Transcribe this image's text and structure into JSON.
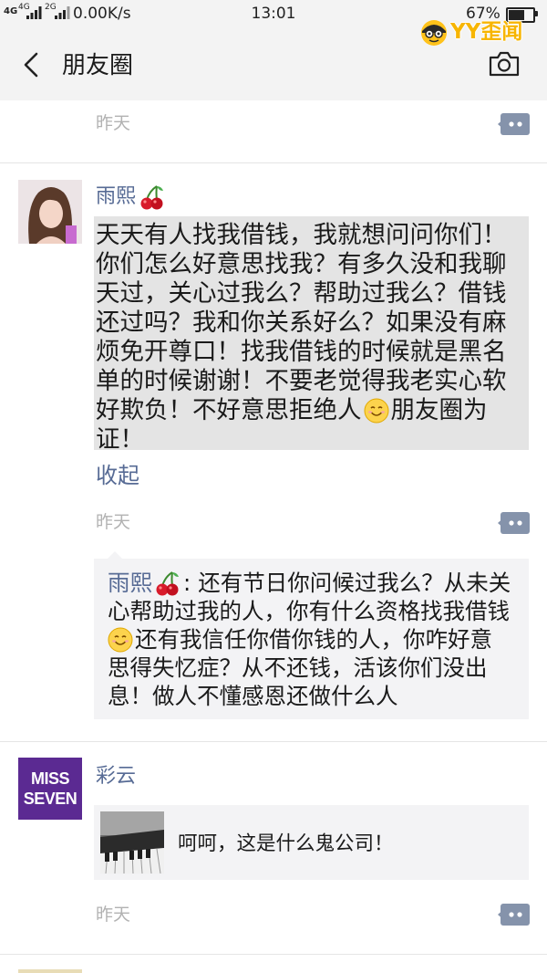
{
  "status_bar": {
    "network_a": "4G",
    "network_b": "4G",
    "network_c": "2G",
    "speed": "0.00K/s",
    "time": "13:01",
    "battery_text": "67%",
    "battery_level": 67
  },
  "watermark": {
    "text": "YY歪闻",
    "icon": "yy-logo-icon"
  },
  "nav": {
    "title": "朋友圈",
    "back_icon": "chevron-left-icon",
    "camera_icon": "camera-icon"
  },
  "feed": {
    "previous_post": {
      "time": "昨天"
    },
    "posts": [
      {
        "author": "雨熙",
        "author_emoji": "cherry-icon",
        "text_lines": [
          "天天有人找我借钱，我就想问问你们！",
          "你们怎么好意思找我？有多久没和我聊",
          "天过，关心过我么？帮助过我么？借钱",
          "还过吗？我和你关系好么？如果没有麻",
          "烦免开尊口！找我借钱的时候就是黑名",
          "单的时候谢谢！不要老觉得我老实心软",
          {
            "before_emoji": "好欺负！不好意思拒绝人",
            "emoji": "smile-icon",
            "after_emoji": "朋友圈为"
          },
          "证！"
        ],
        "collapse_label": "收起",
        "time": "昨天",
        "comments": [
          {
            "author": "雨熙",
            "author_emoji": "cherry-icon",
            "separator": ":",
            "text_lines": [
              "还有节日你问候过我么？从未关",
              "心帮助过我的人，你有什么资格找我借钱",
              {
                "emoji": "smile-icon",
                "after_emoji": "还有我信任你借你钱的人，你咋好意"
              },
              "思得失忆症？从不还钱，活该你们没出",
              "息！做人不懂感恩还做什么人"
            ]
          }
        ]
      },
      {
        "author": "彩云",
        "avatar_text": [
          "MISS",
          "SEVEN"
        ],
        "link": {
          "title": "呵呵，这是什么鬼公司！"
        },
        "time": "昨天"
      }
    ]
  },
  "colors": {
    "header_bg": "#f3f3f3",
    "link_blue": "#576b95",
    "time_gray": "#b2b2b2",
    "selected_text_bg": "#e4e4e4",
    "comment_bg": "#f3f3f5",
    "avatar_purple": "#5b2a92",
    "watermark_gold": "#f7b500"
  }
}
